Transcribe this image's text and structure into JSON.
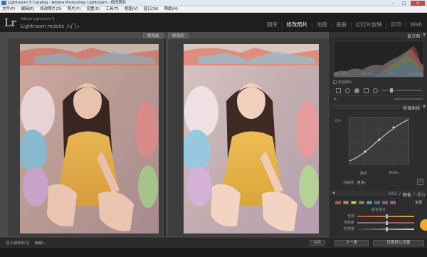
{
  "window": {
    "title": "Lightroom 5 Catalog - Adobe Photoshop Lightroom - 修改照片",
    "buttons": [
      "–",
      "□",
      "×"
    ]
  },
  "menu": [
    "文件(F)",
    "编辑(E)",
    "修改照片(D)",
    "照片(P)",
    "设置(S)",
    "工具(T)",
    "视图(V)",
    "窗口(W)",
    "帮助(H)"
  ],
  "identity": {
    "logo": "Lr",
    "edition": "Adobe Lightroom 5",
    "mobile": "Lightroom mobile 入门",
    "mobile_caret": "▸"
  },
  "modules": {
    "items": [
      "图库",
      "修改照片",
      "地图",
      "画册",
      "幻灯片放映",
      "打印",
      "Web"
    ],
    "active": "修改照片"
  },
  "compare": {
    "before_label": "修改前",
    "after_label": "修改后"
  },
  "toolbar": {
    "label": "显示编辑标记:",
    "value": "自动",
    "caret": "▾",
    "done_button": "完成"
  },
  "right_panel": {
    "histogram_title": "直方图",
    "histogram_readout": [
      "ISO 200",
      "50 mm",
      "f/2.0",
      "1/640 秒"
    ],
    "original_photo": "原始照片",
    "tone_curve_title": "色调曲线",
    "curve_corner": "高光",
    "curve_bottom_left": "通道",
    "curve_bottom_right": "RGB",
    "point_curve_label": "点曲线:",
    "point_curve_value": "自定",
    "hsl_parts": [
      "HSL",
      "/",
      "颜色",
      "/",
      "黑白"
    ],
    "hsl_active": "颜色",
    "all_label": "全部",
    "color_sub": "颜色混合",
    "sliders": [
      {
        "label": "色相",
        "value": 0.5
      },
      {
        "label": "饱和度",
        "value": 0.5
      },
      {
        "label": "明亮度",
        "value": 0.5
      }
    ],
    "prev_button": "上一张",
    "reset_button": "设置默认设置"
  },
  "colors": {
    "accent_orange": "#f0a82d",
    "panel_bg": "#2d2d2d",
    "workarea_bg": "#4a4a4a"
  }
}
